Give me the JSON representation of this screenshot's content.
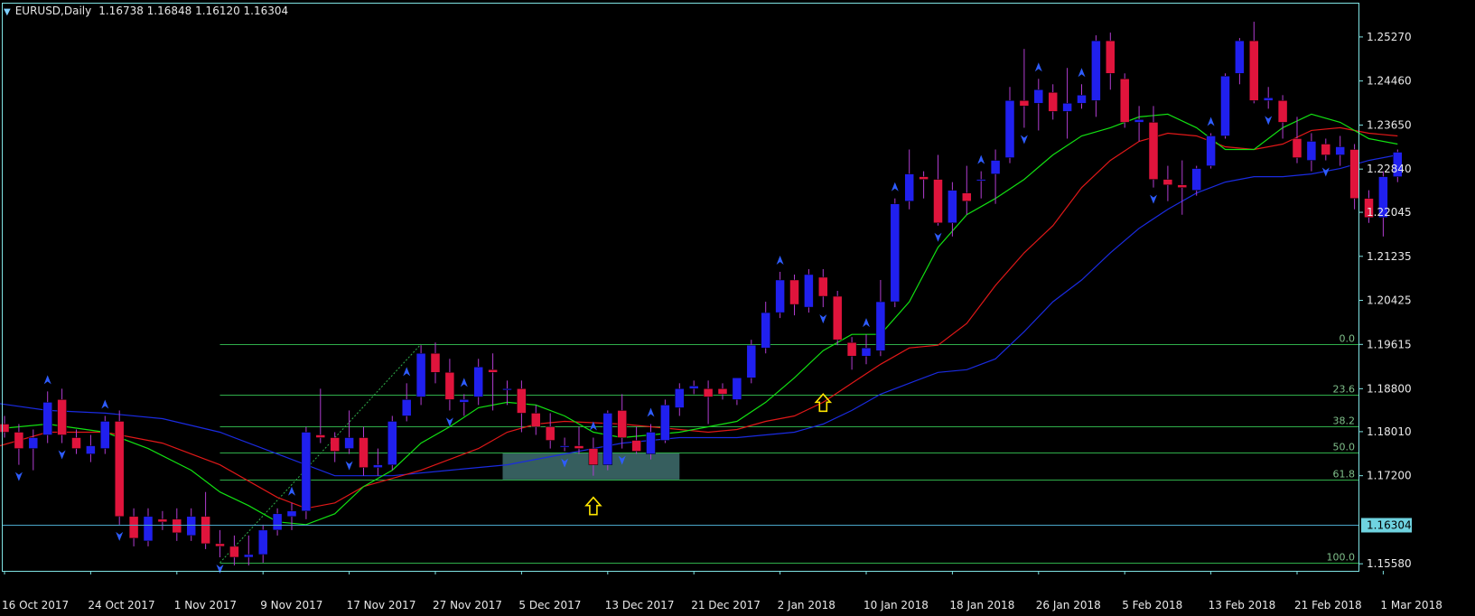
{
  "header": {
    "symbol": "EURUSD,Daily",
    "ohlc": "1.16738 1.16848 1.16120 1.16304"
  },
  "colors": {
    "background": "#000000",
    "frame": "#7fe3e3",
    "bull_candle": "#2020ee",
    "bear_candle": "#e0143c",
    "wick": "#b03cd0",
    "ma_fast": "#12e012",
    "ma_mid": "#e01818",
    "ma_slow": "#1a2be0",
    "fib_line": "#2fae4a",
    "fractal": "#2e5cff",
    "zone": "#3f6e6e",
    "arrow": "#ffe600",
    "price_line": "#4aa6c8",
    "axis_text": "#e8e8e8"
  },
  "chart_data": {
    "type": "candlestick",
    "ylim": [
      1.1545,
      1.259
    ],
    "price_ticks": [
      "1.25270",
      "1.24460",
      "1.23650",
      "1.22840",
      "1.22045",
      "1.21235",
      "1.20425",
      "1.19615",
      "1.18800",
      "1.18010",
      "1.17200",
      "1.15580"
    ],
    "current_price": "1.16304",
    "date_labels": [
      {
        "label": "16 Oct 2017",
        "bar": 0
      },
      {
        "label": "24 Oct 2017",
        "bar": 6
      },
      {
        "label": "1 Nov 2017",
        "bar": 12
      },
      {
        "label": "9 Nov 2017",
        "bar": 18
      },
      {
        "label": "17 Nov 2017",
        "bar": 24
      },
      {
        "label": "27 Nov 2017",
        "bar": 30
      },
      {
        "label": "5 Dec 2017",
        "bar": 36
      },
      {
        "label": "13 Dec 2017",
        "bar": 42
      },
      {
        "label": "21 Dec 2017",
        "bar": 48
      },
      {
        "label": "2 Jan 2018",
        "bar": 54
      },
      {
        "label": "10 Jan 2018",
        "bar": 60
      },
      {
        "label": "18 Jan 2018",
        "bar": 66
      },
      {
        "label": "26 Jan 2018",
        "bar": 72
      },
      {
        "label": "5 Feb 2018",
        "bar": 78
      },
      {
        "label": "13 Feb 2018",
        "bar": 84
      },
      {
        "label": "21 Feb 2018",
        "bar": 90
      },
      {
        "label": "1 Mar 2018",
        "bar": 96
      }
    ],
    "candles": [
      [
        1.1815,
        1.183,
        1.179,
        1.18
      ],
      [
        1.18,
        1.1815,
        1.174,
        1.177
      ],
      [
        1.177,
        1.1805,
        1.173,
        1.179
      ],
      [
        1.1795,
        1.1875,
        1.178,
        1.1855
      ],
      [
        1.186,
        1.188,
        1.178,
        1.1795
      ],
      [
        1.179,
        1.1805,
        1.176,
        1.177
      ],
      [
        1.176,
        1.1795,
        1.1745,
        1.1775
      ],
      [
        1.177,
        1.183,
        1.176,
        1.182
      ],
      [
        1.182,
        1.184,
        1.163,
        1.1645
      ],
      [
        1.1645,
        1.166,
        1.159,
        1.1605
      ],
      [
        1.16,
        1.166,
        1.159,
        1.1645
      ],
      [
        1.164,
        1.1655,
        1.162,
        1.1635
      ],
      [
        1.164,
        1.166,
        1.16,
        1.1615
      ],
      [
        1.161,
        1.166,
        1.16,
        1.1645
      ],
      [
        1.1645,
        1.169,
        1.1585,
        1.1595
      ],
      [
        1.1595,
        1.162,
        1.157,
        1.159
      ],
      [
        1.159,
        1.161,
        1.1555,
        1.157
      ],
      [
        1.157,
        1.161,
        1.1555,
        1.1575
      ],
      [
        1.1575,
        1.163,
        1.156,
        1.162
      ],
      [
        1.162,
        1.166,
        1.161,
        1.165
      ],
      [
        1.1645,
        1.167,
        1.162,
        1.1655
      ],
      [
        1.1655,
        1.181,
        1.164,
        1.18
      ],
      [
        1.1795,
        1.188,
        1.178,
        1.179
      ],
      [
        1.179,
        1.18,
        1.1745,
        1.1765
      ],
      [
        1.177,
        1.184,
        1.176,
        1.179
      ],
      [
        1.179,
        1.181,
        1.172,
        1.1735
      ],
      [
        1.1735,
        1.177,
        1.172,
        1.174
      ],
      [
        1.174,
        1.183,
        1.173,
        1.182
      ],
      [
        1.183,
        1.189,
        1.182,
        1.186
      ],
      [
        1.1865,
        1.196,
        1.185,
        1.1945
      ],
      [
        1.1945,
        1.1965,
        1.189,
        1.191
      ],
      [
        1.191,
        1.1935,
        1.184,
        1.186
      ],
      [
        1.1855,
        1.187,
        1.183,
        1.186
      ],
      [
        1.1865,
        1.1935,
        1.185,
        1.192
      ],
      [
        1.1915,
        1.1945,
        1.184,
        1.191
      ],
      [
        1.188,
        1.1895,
        1.185,
        1.188
      ],
      [
        1.188,
        1.1895,
        1.18,
        1.1835
      ],
      [
        1.1835,
        1.185,
        1.1795,
        1.181
      ],
      [
        1.181,
        1.1835,
        1.177,
        1.1785
      ],
      [
        1.1775,
        1.179,
        1.1765,
        1.1775
      ],
      [
        1.1775,
        1.181,
        1.176,
        1.177
      ],
      [
        1.177,
        1.179,
        1.172,
        1.174
      ],
      [
        1.174,
        1.184,
        1.173,
        1.1835
      ],
      [
        1.184,
        1.187,
        1.177,
        1.179
      ],
      [
        1.1785,
        1.181,
        1.176,
        1.1765
      ],
      [
        1.176,
        1.1815,
        1.175,
        1.18
      ],
      [
        1.1785,
        1.186,
        1.178,
        1.185
      ],
      [
        1.1845,
        1.189,
        1.183,
        1.188
      ],
      [
        1.188,
        1.1895,
        1.187,
        1.1885
      ],
      [
        1.188,
        1.1895,
        1.1815,
        1.1865
      ],
      [
        1.188,
        1.189,
        1.186,
        1.187
      ],
      [
        1.186,
        1.19,
        1.185,
        1.19
      ],
      [
        1.19,
        1.197,
        1.189,
        1.196
      ],
      [
        1.1955,
        1.204,
        1.1945,
        1.202
      ],
      [
        1.202,
        1.2095,
        1.201,
        1.208
      ],
      [
        1.208,
        1.209,
        1.2015,
        1.2035
      ],
      [
        1.203,
        1.21,
        1.202,
        1.209
      ],
      [
        1.2085,
        1.21,
        1.203,
        1.205
      ],
      [
        1.205,
        1.206,
        1.196,
        1.197
      ],
      [
        1.1965,
        1.1975,
        1.1915,
        1.194
      ],
      [
        1.194,
        1.198,
        1.1925,
        1.1955
      ],
      [
        1.195,
        1.208,
        1.194,
        1.204
      ],
      [
        1.204,
        1.223,
        1.203,
        1.222
      ],
      [
        1.2225,
        1.232,
        1.221,
        1.2275
      ],
      [
        1.227,
        1.228,
        1.223,
        1.2265
      ],
      [
        1.2265,
        1.231,
        1.218,
        1.2185
      ],
      [
        1.2185,
        1.226,
        1.216,
        1.2245
      ],
      [
        1.224,
        1.229,
        1.22,
        1.2225
      ],
      [
        1.2265,
        1.228,
        1.223,
        1.2265
      ],
      [
        1.2275,
        1.232,
        1.222,
        1.23
      ],
      [
        1.2305,
        1.2435,
        1.2295,
        1.241
      ],
      [
        1.241,
        1.2505,
        1.236,
        1.24
      ],
      [
        1.2405,
        1.245,
        1.2355,
        1.243
      ],
      [
        1.2425,
        1.244,
        1.2375,
        1.239
      ],
      [
        1.239,
        1.247,
        1.234,
        1.2405
      ],
      [
        1.2405,
        1.244,
        1.2395,
        1.242
      ],
      [
        1.241,
        1.253,
        1.238,
        1.252
      ],
      [
        1.252,
        1.2535,
        1.243,
        1.246
      ],
      [
        1.245,
        1.246,
        1.236,
        1.237
      ],
      [
        1.237,
        1.24,
        1.2335,
        1.2375
      ],
      [
        1.237,
        1.24,
        1.225,
        1.2265
      ],
      [
        1.2265,
        1.229,
        1.2225,
        1.2255
      ],
      [
        1.2255,
        1.23,
        1.22,
        1.225
      ],
      [
        1.2245,
        1.229,
        1.2235,
        1.2285
      ],
      [
        1.229,
        1.235,
        1.2285,
        1.2345
      ],
      [
        1.2345,
        1.246,
        1.234,
        1.2455
      ],
      [
        1.246,
        1.2525,
        1.244,
        1.252
      ],
      [
        1.252,
        1.2555,
        1.2405,
        1.241
      ],
      [
        1.241,
        1.2435,
        1.2395,
        1.2415
      ],
      [
        1.241,
        1.242,
        1.234,
        1.237
      ],
      [
        1.234,
        1.238,
        1.2295,
        1.2305
      ],
      [
        1.23,
        1.235,
        1.228,
        1.2335
      ],
      [
        1.233,
        1.234,
        1.23,
        1.231
      ],
      [
        1.231,
        1.2345,
        1.229,
        1.2325
      ],
      [
        1.232,
        1.233,
        1.221,
        1.223
      ],
      [
        1.223,
        1.2245,
        1.2185,
        1.2195
      ],
      [
        1.2195,
        1.228,
        1.216,
        1.227
      ],
      [
        1.227,
        1.232,
        1.226,
        1.2315
      ]
    ],
    "ma_fast_points": [
      [
        -1,
        1.1805
      ],
      [
        3,
        1.1815
      ],
      [
        7,
        1.18
      ],
      [
        10,
        1.177
      ],
      [
        13,
        1.173
      ],
      [
        15,
        1.169
      ],
      [
        17,
        1.1665
      ],
      [
        19,
        1.1635
      ],
      [
        21,
        1.163
      ],
      [
        23,
        1.165
      ],
      [
        25,
        1.17
      ],
      [
        27,
        1.173
      ],
      [
        29,
        1.178
      ],
      [
        31,
        1.181
      ],
      [
        33,
        1.1845
      ],
      [
        35,
        1.1855
      ],
      [
        37,
        1.185
      ],
      [
        39,
        1.183
      ],
      [
        41,
        1.18
      ],
      [
        43,
        1.179
      ],
      [
        45,
        1.1795
      ],
      [
        47,
        1.18
      ],
      [
        49,
        1.181
      ],
      [
        51,
        1.182
      ],
      [
        53,
        1.1855
      ],
      [
        55,
        1.19
      ],
      [
        57,
        1.195
      ],
      [
        59,
        1.198
      ],
      [
        61,
        1.198
      ],
      [
        63,
        1.204
      ],
      [
        65,
        1.214
      ],
      [
        67,
        1.22
      ],
      [
        69,
        1.223
      ],
      [
        71,
        1.2265
      ],
      [
        73,
        1.231
      ],
      [
        75,
        1.2345
      ],
      [
        77,
        1.236
      ],
      [
        79,
        1.238
      ],
      [
        81,
        1.2385
      ],
      [
        83,
        1.236
      ],
      [
        85,
        1.232
      ],
      [
        87,
        1.232
      ],
      [
        89,
        1.236
      ],
      [
        91,
        1.2385
      ],
      [
        93,
        1.237
      ],
      [
        95,
        1.234
      ],
      [
        97,
        1.233
      ]
    ],
    "ma_mid_points": [
      [
        -1,
        1.177
      ],
      [
        3,
        1.18
      ],
      [
        7,
        1.18
      ],
      [
        11,
        1.178
      ],
      [
        15,
        1.174
      ],
      [
        19,
        1.168
      ],
      [
        21,
        1.166
      ],
      [
        23,
        1.167
      ],
      [
        25,
        1.17
      ],
      [
        27,
        1.1715
      ],
      [
        29,
        1.173
      ],
      [
        31,
        1.175
      ],
      [
        33,
        1.177
      ],
      [
        35,
        1.18
      ],
      [
        37,
        1.1815
      ],
      [
        39,
        1.182
      ],
      [
        43,
        1.1815
      ],
      [
        47,
        1.1805
      ],
      [
        49,
        1.18
      ],
      [
        51,
        1.1805
      ],
      [
        53,
        1.182
      ],
      [
        55,
        1.183
      ],
      [
        57,
        1.1855
      ],
      [
        59,
        1.189
      ],
      [
        61,
        1.1925
      ],
      [
        63,
        1.1955
      ],
      [
        65,
        1.196
      ],
      [
        67,
        1.2
      ],
      [
        69,
        1.207
      ],
      [
        71,
        1.213
      ],
      [
        73,
        1.218
      ],
      [
        75,
        1.225
      ],
      [
        77,
        1.23
      ],
      [
        79,
        1.2335
      ],
      [
        81,
        1.235
      ],
      [
        83,
        1.2345
      ],
      [
        85,
        1.2325
      ],
      [
        87,
        1.232
      ],
      [
        89,
        1.233
      ],
      [
        91,
        1.2355
      ],
      [
        93,
        1.236
      ],
      [
        95,
        1.235
      ],
      [
        97,
        1.2345
      ]
    ],
    "ma_slow_points": [
      [
        -1,
        1.1855
      ],
      [
        3,
        1.184
      ],
      [
        7,
        1.1835
      ],
      [
        11,
        1.1825
      ],
      [
        15,
        1.18
      ],
      [
        19,
        1.176
      ],
      [
        23,
        1.172
      ],
      [
        27,
        1.172
      ],
      [
        31,
        1.173
      ],
      [
        35,
        1.174
      ],
      [
        39,
        1.176
      ],
      [
        43,
        1.178
      ],
      [
        47,
        1.179
      ],
      [
        51,
        1.179
      ],
      [
        55,
        1.18
      ],
      [
        57,
        1.1815
      ],
      [
        59,
        1.184
      ],
      [
        61,
        1.187
      ],
      [
        63,
        1.189
      ],
      [
        65,
        1.191
      ],
      [
        67,
        1.1915
      ],
      [
        69,
        1.1935
      ],
      [
        71,
        1.1985
      ],
      [
        73,
        1.204
      ],
      [
        75,
        1.208
      ],
      [
        77,
        1.213
      ],
      [
        79,
        1.2175
      ],
      [
        81,
        1.221
      ],
      [
        83,
        1.224
      ],
      [
        85,
        1.226
      ],
      [
        87,
        1.227
      ],
      [
        89,
        1.227
      ],
      [
        91,
        1.2275
      ],
      [
        93,
        1.2285
      ],
      [
        95,
        1.23
      ],
      [
        97,
        1.231
      ]
    ],
    "fib_levels": [
      {
        "label": "0.0",
        "price": 1.1962
      },
      {
        "label": "23.6",
        "price": 1.1869
      },
      {
        "label": "38.2",
        "price": 1.181
      },
      {
        "label": "50.0",
        "price": 1.1762
      },
      {
        "label": "61.8",
        "price": 1.1713
      },
      {
        "label": "100.0",
        "price": 1.156
      }
    ],
    "fib_start_bar": 15,
    "fib_trend": [
      [
        15,
        1.156
      ],
      [
        29,
        1.1962
      ]
    ],
    "zone": {
      "start_bar": 35,
      "end_bar": 47,
      "high": 1.1762,
      "low": 1.1713
    },
    "fractals_up": [
      3,
      7,
      20,
      28,
      32,
      41,
      45,
      54,
      60,
      62,
      68,
      72,
      75,
      84
    ],
    "fractals_down": [
      1,
      4,
      8,
      15,
      24,
      31,
      39,
      43,
      57,
      65,
      71,
      80,
      88,
      92
    ],
    "signal_arrows": [
      {
        "bar": 41,
        "price": 1.17
      },
      {
        "bar": 57,
        "price": 1.189
      }
    ]
  }
}
